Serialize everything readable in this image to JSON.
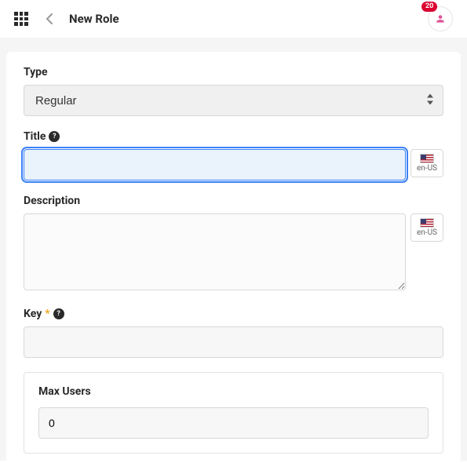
{
  "header": {
    "title": "New Role",
    "badge_count": "20"
  },
  "form": {
    "type": {
      "label": "Type",
      "value": "Regular"
    },
    "title": {
      "label": "Title",
      "value": "",
      "locale": "en-US"
    },
    "description": {
      "label": "Description",
      "value": "",
      "locale": "en-US"
    },
    "key": {
      "label": "Key",
      "value": ""
    },
    "max_users": {
      "label": "Max Users",
      "value": "0"
    }
  },
  "glyphs": {
    "help": "?",
    "required": "*"
  }
}
